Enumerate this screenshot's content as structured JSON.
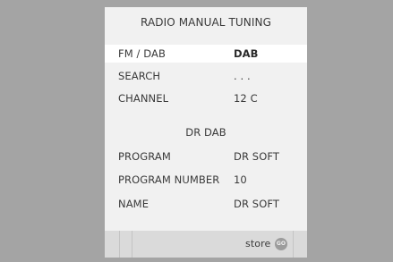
{
  "menu": {
    "title": "RADIO  MANUAL  TUNING",
    "rows": [
      {
        "label": "FM / DAB",
        "value": "DAB"
      },
      {
        "label": "SEARCH",
        "value": ". . ."
      },
      {
        "label": "CHANNEL",
        "value": "12 C"
      }
    ],
    "section_title": "DR  DAB",
    "program_rows": [
      {
        "label": "PROGRAM",
        "value": "DR  SOFT"
      },
      {
        "label": "PROGRAM  NUMBER",
        "value": "10"
      },
      {
        "label": "NAME",
        "value": "DR  SOFT"
      }
    ]
  },
  "footer": {
    "store_label": "store",
    "go_label": "GO",
    "icon": "go-button-icon"
  },
  "colors": {
    "background": "#a4a4a4",
    "panel": "#f1f1f1",
    "selected_row": "#ffffff",
    "footer": "#dadada"
  }
}
